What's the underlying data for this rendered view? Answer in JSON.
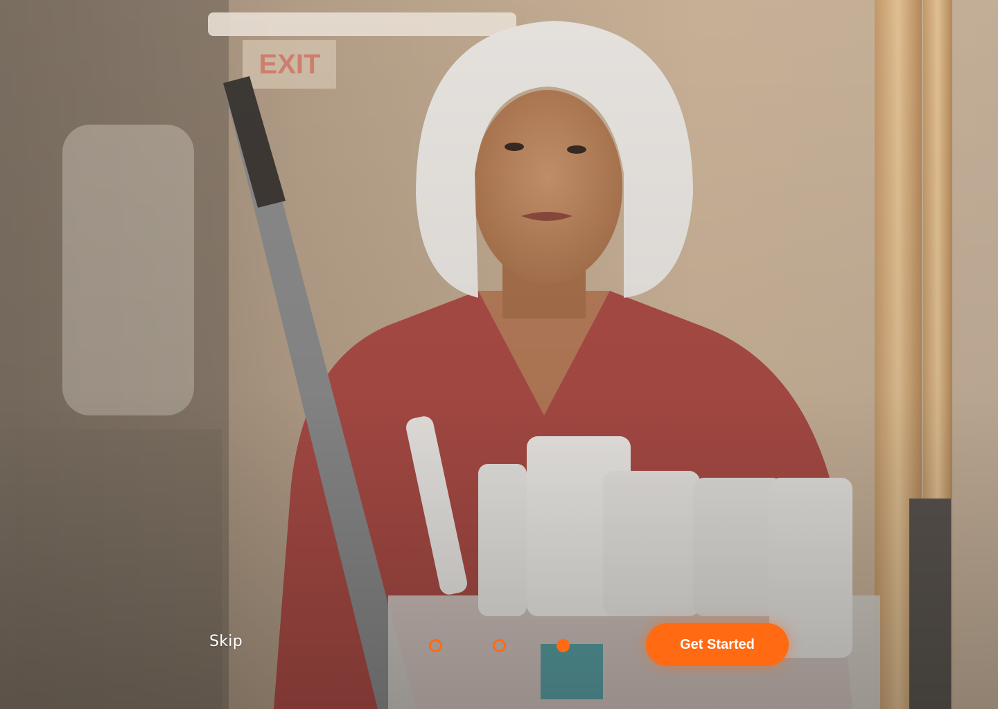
{
  "onboarding": {
    "skip_label": "Skip",
    "cta_label": "Get Started",
    "pagination": {
      "total": 3,
      "active_index": 2
    },
    "accent_color": "#ff6a13",
    "background_image": "photo of hospital cleaning worker with hairnet behind a cart of cleaning bottles"
  }
}
